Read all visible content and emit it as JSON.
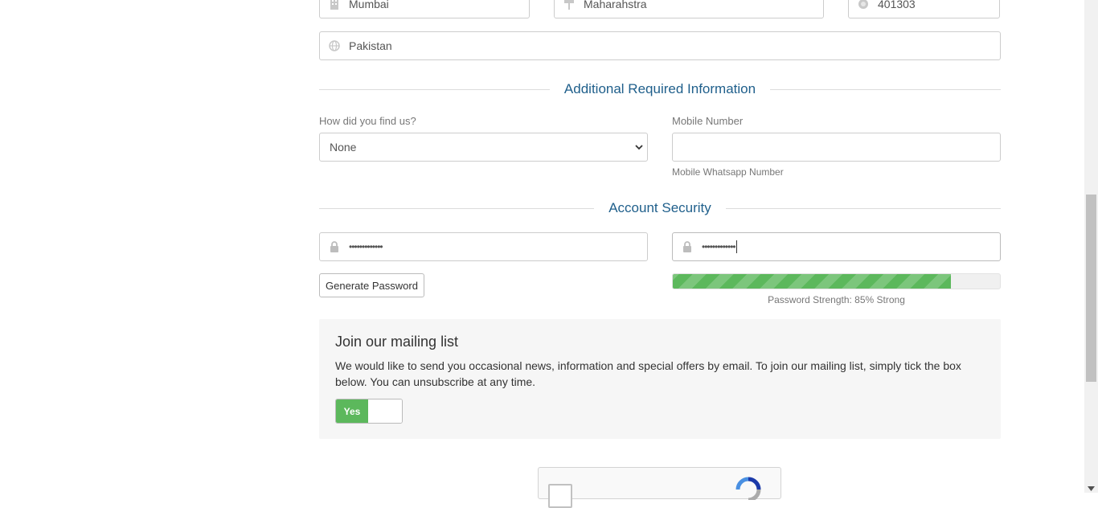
{
  "address": {
    "city": "Mumbai",
    "state": "Maharahstra",
    "postcode": "401303",
    "country": "Pakistan"
  },
  "additional": {
    "heading": "Additional Required Information",
    "find_us_label": "How did you find us?",
    "find_us_value": "None",
    "mobile_label": "Mobile Number",
    "mobile_value": "",
    "mobile_help": "Mobile Whatsapp Number"
  },
  "security": {
    "heading": "Account Security",
    "password_mask": "•••••••••••••",
    "confirm_mask": "•••••••••••••",
    "generate_label": "Generate Password",
    "strength_text": "Password Strength: 85% Strong",
    "strength_percent": 85
  },
  "mailing": {
    "title": "Join our mailing list",
    "description": "We would like to send you occasional news, information and special offers by email. To join our mailing list, simply tick the box below. You can unsubscribe at any time.",
    "toggle_label": "Yes",
    "toggle_on": true
  },
  "colors": {
    "accent_heading": "#1f5f8b",
    "success_green": "#5cb85c",
    "panel_bg": "#f6f6f6"
  },
  "icons": {
    "city": "building-icon",
    "state": "signpost-icon",
    "postcode": "certificate-icon",
    "country": "globe-icon",
    "password": "lock-icon",
    "recaptcha": "recaptcha-icon"
  }
}
